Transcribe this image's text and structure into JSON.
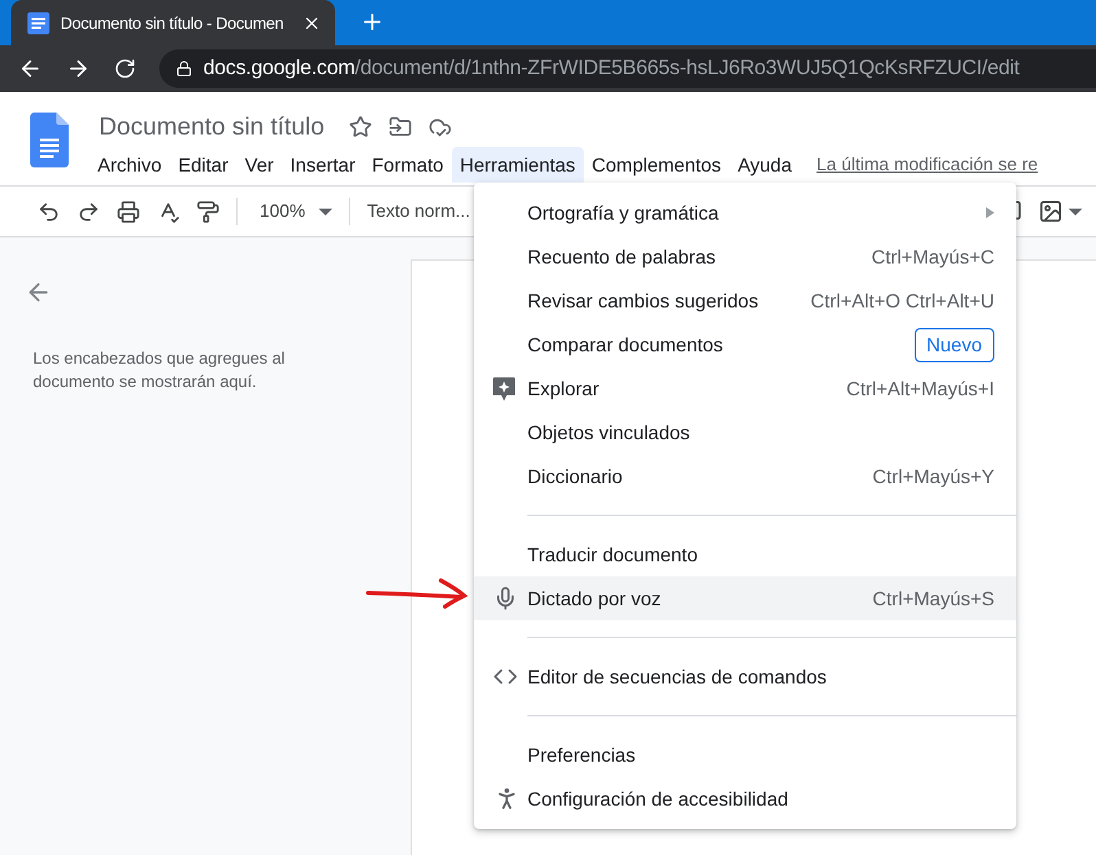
{
  "browser": {
    "tab_title": "Documento sin título - Documen",
    "url_host": "docs.google.com",
    "url_path": "/document/d/1nthn-ZFrWIDE5B665s-hsLJ6Ro3WUJ5Q1QcKsRFZUCI/edit"
  },
  "document": {
    "title": "Documento sin título"
  },
  "menubar": [
    {
      "label": "Archivo",
      "selected": false
    },
    {
      "label": "Editar",
      "selected": false
    },
    {
      "label": "Ver",
      "selected": false
    },
    {
      "label": "Insertar",
      "selected": false
    },
    {
      "label": "Formato",
      "selected": false
    },
    {
      "label": "Herramientas",
      "selected": true
    },
    {
      "label": "Complementos",
      "selected": false
    },
    {
      "label": "Ayuda",
      "selected": false
    }
  ],
  "last_edit": "La última modificación se re",
  "toolbar": {
    "zoom": "100%",
    "style": "Texto norm..."
  },
  "outline": {
    "message": "Los encabezados que agregues al documento se mostrarán aquí."
  },
  "tools_menu": [
    {
      "kind": "submenu",
      "label": "Ortografía y gramática",
      "selected": false
    },
    {
      "kind": "plain",
      "label": "Recuento de palabras",
      "shortcut": "Ctrl+Mayús+C",
      "selected": false
    },
    {
      "kind": "plain",
      "label": "Revisar cambios sugeridos",
      "shortcut": "Ctrl+Alt+O Ctrl+Alt+U",
      "selected": false
    },
    {
      "kind": "badge",
      "label": "Comparar documentos",
      "badge": "Nuevo",
      "selected": false
    },
    {
      "kind": "explore",
      "label": "Explorar",
      "shortcut": "Ctrl+Alt+Mayús+I",
      "selected": false
    },
    {
      "kind": "plain",
      "label": "Objetos vinculados",
      "selected": false
    },
    {
      "kind": "plain",
      "label": "Diccionario",
      "shortcut": "Ctrl+Mayús+Y",
      "selected": false
    },
    {
      "kind": "separator"
    },
    {
      "kind": "plain",
      "label": "Traducir documento",
      "selected": false
    },
    {
      "kind": "voice",
      "label": "Dictado por voz",
      "shortcut": "Ctrl+Mayús+S",
      "selected": true
    },
    {
      "kind": "separator"
    },
    {
      "kind": "code",
      "label": "Editor de secuencias de comandos",
      "selected": false
    },
    {
      "kind": "separator"
    },
    {
      "kind": "plain",
      "label": "Preferencias",
      "selected": false
    },
    {
      "kind": "accessibility",
      "label": "Configuración de accesibilidad",
      "selected": false
    }
  ]
}
